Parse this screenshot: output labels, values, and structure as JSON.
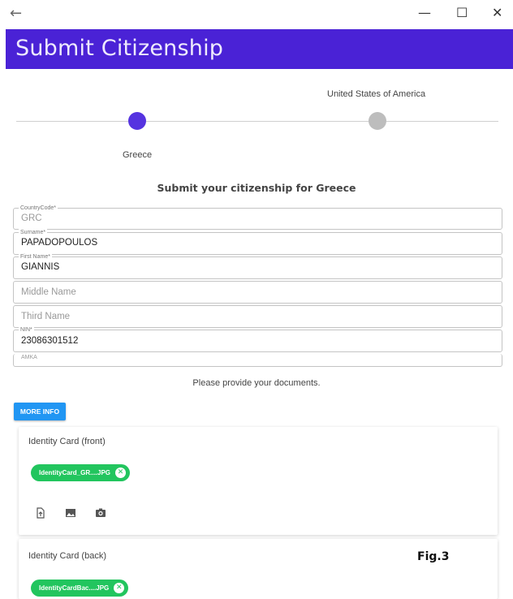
{
  "window": {
    "back_glyph": "←",
    "minimize_glyph": "—",
    "maximize_glyph": "☐",
    "close_glyph": "✕"
  },
  "appbar": {
    "title": "Submit Citizenship",
    "color": "#4a22d6"
  },
  "stepper": {
    "steps": [
      {
        "label": "Greece",
        "state": "active"
      },
      {
        "label": "United States of America",
        "state": "inactive"
      }
    ],
    "active_color": "#5533e0",
    "inactive_color": "#bdbdbd"
  },
  "form": {
    "heading": "Submit your citizenship for Greece",
    "fields": [
      {
        "label": "CountryCode*",
        "value": "GRC"
      },
      {
        "label": "Surname*",
        "value": "PAPADOPOULOS"
      },
      {
        "label": "First Name*",
        "value": "GIANNIS"
      },
      {
        "label": "",
        "placeholder": "Middle Name"
      },
      {
        "label": "",
        "placeholder": "Third Name"
      },
      {
        "label": "NIN*",
        "value": "23086301512"
      },
      {
        "label": "AMKA",
        "value": ""
      }
    ]
  },
  "documents": {
    "prompt": "Please provide your documents.",
    "more_info_label": "MORE INFO",
    "cards": [
      {
        "title": "Identity Card (front)",
        "file_chip": "IdentityCard_GR....JPG"
      },
      {
        "title": "Identity Card (back)",
        "file_chip": "IdentityCardBac....JPG"
      }
    ]
  },
  "figure_label": "Fig.3",
  "chip_color": "#22c55e"
}
